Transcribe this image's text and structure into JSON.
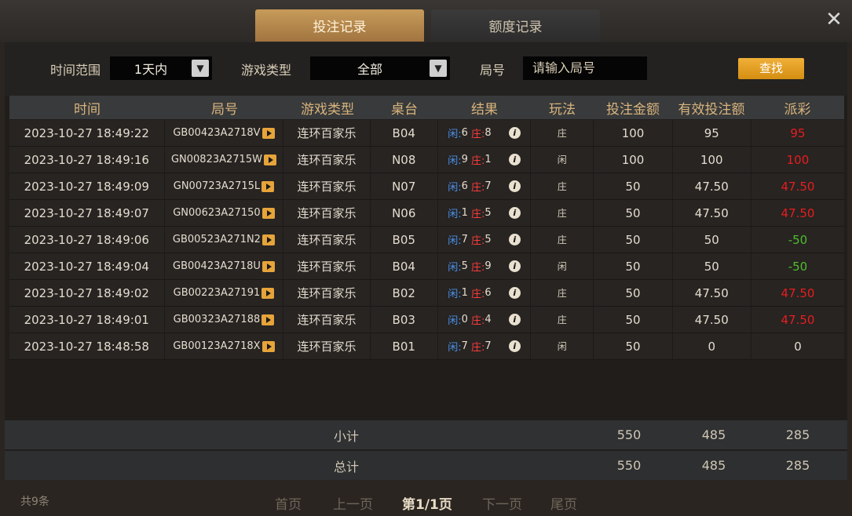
{
  "tabs": [
    {
      "label": "投注记录"
    },
    {
      "label": "额度记录"
    }
  ],
  "close_glyph": "✕",
  "filters": {
    "time_label": "时间范围",
    "time_value": "1天内",
    "game_label": "游戏类型",
    "game_value": "全部",
    "round_label": "局号",
    "round_placeholder": "请输入局号",
    "search_label": "查找"
  },
  "table": {
    "headers": [
      "时间",
      "局号",
      "游戏类型",
      "桌台",
      "结果",
      "玩法",
      "投注金额",
      "有效投注额",
      "派彩"
    ],
    "rows": [
      {
        "time": "2023-10-27 18:49:22",
        "round": "GB00423A2718V",
        "game": "连环百家乐",
        "table": "B04",
        "player_label": "闲:",
        "player": "6",
        "banker_label": "庄:",
        "banker": "8",
        "play": "庄",
        "bet": "100",
        "valid": "95",
        "payout": "95",
        "payout_color": "red"
      },
      {
        "time": "2023-10-27 18:49:16",
        "round": "GN00823A2715W",
        "game": "连环百家乐",
        "table": "N08",
        "player_label": "闲:",
        "player": "9",
        "banker_label": "庄:",
        "banker": "1",
        "play": "闲",
        "bet": "100",
        "valid": "100",
        "payout": "100",
        "payout_color": "red"
      },
      {
        "time": "2023-10-27 18:49:09",
        "round": "GN00723A2715L",
        "game": "连环百家乐",
        "table": "N07",
        "player_label": "闲:",
        "player": "6",
        "banker_label": "庄:",
        "banker": "7",
        "play": "庄",
        "bet": "50",
        "valid": "47.50",
        "payout": "47.50",
        "payout_color": "red"
      },
      {
        "time": "2023-10-27 18:49:07",
        "round": "GN00623A27150",
        "game": "连环百家乐",
        "table": "N06",
        "player_label": "闲:",
        "player": "1",
        "banker_label": "庄:",
        "banker": "5",
        "play": "庄",
        "bet": "50",
        "valid": "47.50",
        "payout": "47.50",
        "payout_color": "red"
      },
      {
        "time": "2023-10-27 18:49:06",
        "round": "GB00523A271N2",
        "game": "连环百家乐",
        "table": "B05",
        "player_label": "闲:",
        "player": "7",
        "banker_label": "庄:",
        "banker": "5",
        "play": "庄",
        "bet": "50",
        "valid": "50",
        "payout": "-50",
        "payout_color": "green"
      },
      {
        "time": "2023-10-27 18:49:04",
        "round": "GB00423A2718U",
        "game": "连环百家乐",
        "table": "B04",
        "player_label": "闲:",
        "player": "5",
        "banker_label": "庄:",
        "banker": "9",
        "play": "闲",
        "bet": "50",
        "valid": "50",
        "payout": "-50",
        "payout_color": "green"
      },
      {
        "time": "2023-10-27 18:49:02",
        "round": "GB00223A27191",
        "game": "连环百家乐",
        "table": "B02",
        "player_label": "闲:",
        "player": "1",
        "banker_label": "庄:",
        "banker": "6",
        "play": "庄",
        "bet": "50",
        "valid": "47.50",
        "payout": "47.50",
        "payout_color": "red"
      },
      {
        "time": "2023-10-27 18:49:01",
        "round": "GB00323A27188",
        "game": "连环百家乐",
        "table": "B03",
        "player_label": "闲:",
        "player": "0",
        "banker_label": "庄:",
        "banker": "4",
        "play": "庄",
        "bet": "50",
        "valid": "47.50",
        "payout": "47.50",
        "payout_color": "red"
      },
      {
        "time": "2023-10-27 18:48:58",
        "round": "GB00123A2718X",
        "game": "连环百家乐",
        "table": "B01",
        "player_label": "闲:",
        "player": "7",
        "banker_label": "庄:",
        "banker": "7",
        "play": "闲",
        "bet": "50",
        "valid": "0",
        "payout": "0",
        "payout_color": "white"
      }
    ]
  },
  "subtotal": {
    "label": "小计",
    "bet": "550",
    "valid": "485",
    "payout": "285"
  },
  "total": {
    "label": "总计",
    "bet": "550",
    "valid": "485",
    "payout": "285"
  },
  "footer": {
    "count": "共9条",
    "first": "首页",
    "prev": "上一页",
    "current": "第1/1页",
    "next": "下一页",
    "last": "尾页"
  }
}
